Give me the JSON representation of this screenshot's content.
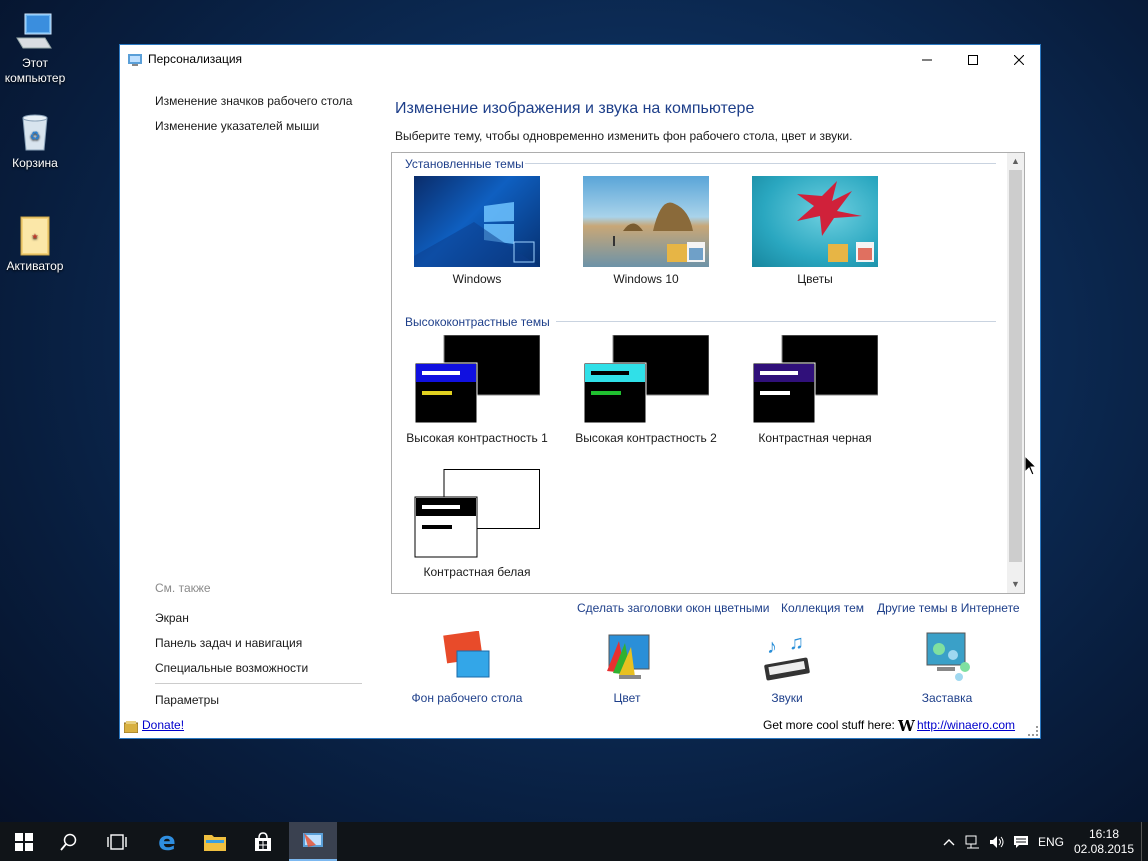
{
  "desktop": {
    "icons": [
      {
        "label": "Этот компьютер",
        "icon": "computer-icon"
      },
      {
        "label": "Корзина",
        "icon": "recycle-bin-icon"
      },
      {
        "label": "Активатор",
        "icon": "folder-icon"
      }
    ]
  },
  "window": {
    "title": "Персонализация",
    "sidebar": {
      "links": [
        "Изменение значков рабочего стола",
        "Изменение указателей мыши"
      ],
      "see_also_title": "См. также",
      "see_also": [
        "Экран",
        "Панель задач и навигация",
        "Специальные возможности"
      ],
      "settings": "Параметры"
    },
    "heading": "Изменение изображения и звука на компьютере",
    "subtext": "Выберите тему, чтобы одновременно изменить фон рабочего стола, цвет и звуки.",
    "groups": {
      "installed": {
        "title": "Установленные темы",
        "themes": [
          "Windows",
          "Windows 10",
          "Цветы"
        ]
      },
      "high_contrast": {
        "title": "Высококонтрастные темы",
        "themes": [
          "Высокая контрастность 1",
          "Высокая контрастность 2",
          "Контрастная черная",
          "Контрастная белая"
        ]
      }
    },
    "links": {
      "color_titles": "Сделать заголовки окон цветными",
      "collection": "Коллекция тем",
      "online": "Другие темы в Интернете"
    },
    "bottom": {
      "background": "Фон рабочего стола",
      "color": "Цвет",
      "sounds": "Звуки",
      "screensaver": "Заставка"
    },
    "status": {
      "donate": "Donate!",
      "getmore": "Get more cool stuff here:",
      "site": "http://winaero.com"
    }
  },
  "taskbar": {
    "lang": "ENG",
    "time": "16:18",
    "date": "02.08.2015"
  },
  "colors": {
    "accent": "#1e3f8a",
    "window_border": "#2b79c2",
    "taskbar": "#101418"
  }
}
